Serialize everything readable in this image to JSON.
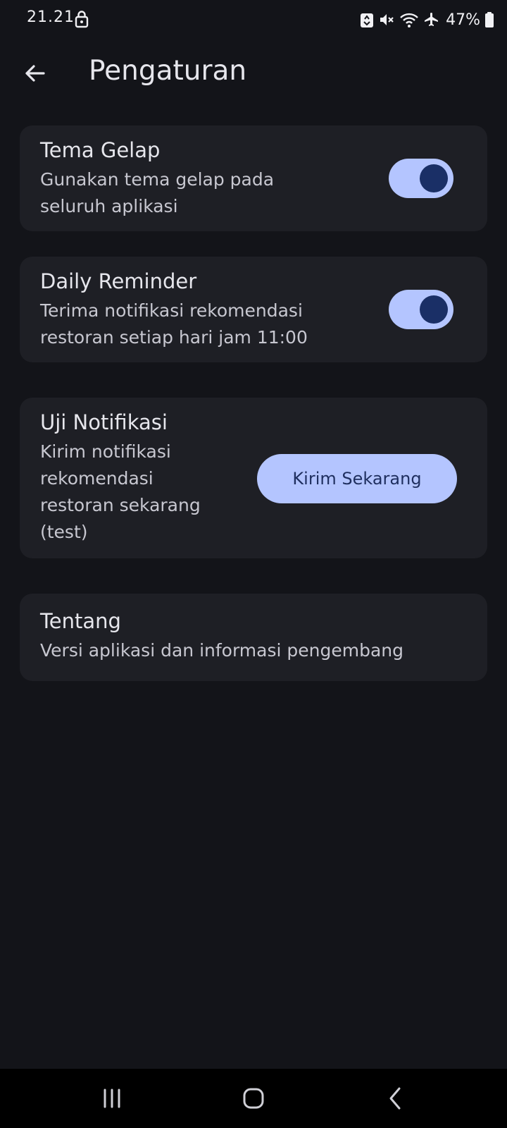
{
  "status_bar": {
    "time": "21.21",
    "battery": "47%",
    "icons": [
      "lock-icon",
      "recycle-icon",
      "mute-icon",
      "wifi-icon",
      "airplane-icon",
      "battery-icon"
    ]
  },
  "app_bar": {
    "title": "Pengaturan",
    "back_icon": "arrow-left-icon"
  },
  "settings": {
    "dark_theme": {
      "title": "Tema Gelap",
      "desc_line1": "Gunakan tema gelap pada",
      "desc_line2": "seluruh aplikasi",
      "enabled": true
    },
    "daily_reminder": {
      "title": "Daily Reminder",
      "desc_line1": "Terima notifikasi rekomendasi",
      "desc_line2": "restoran setiap hari jam 11:00",
      "enabled": true
    },
    "test_notification": {
      "title": "Uji Notifikasi",
      "desc_line1": "Kirim notifikasi",
      "desc_line2": "rekomendasi",
      "desc_line3": "restoran sekarang",
      "desc_line4": "(test)",
      "button_label": "Kirim Sekarang"
    },
    "about": {
      "title": "Tentang",
      "desc": "Versi aplikasi dan informasi pengembang"
    }
  },
  "nav_bar": {
    "icons": [
      "recent-apps-icon",
      "home-icon",
      "back-icon"
    ]
  },
  "colors": {
    "background": "#131419",
    "card": "#1e1f25",
    "accent": "#b4c5ff",
    "accent_dark": "#1a2f66"
  }
}
